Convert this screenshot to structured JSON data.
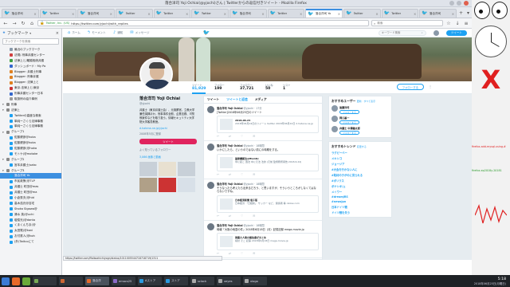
{
  "window": {
    "title": "落合洋司 Yoji Ochiai(@yjochi)さん | Twitterからの返信付きツイート - Mozilla Firefox"
  },
  "tabs": [
    {
      "label": "落合洋司"
    },
    {
      "label": "Twitter"
    },
    {
      "label": "落合洋司"
    },
    {
      "label": "Twitter"
    },
    {
      "label": "Twitter"
    },
    {
      "label": "Twitter"
    },
    {
      "label": "落合洋司"
    },
    {
      "label": "Twitter"
    },
    {
      "label": "落合洋司 Yo",
      "active": true
    },
    {
      "label": "Twitter"
    },
    {
      "label": "Twitter"
    },
    {
      "label": "落合洋司"
    }
  ],
  "navbar": {
    "site": "Twitter, Inc. (US)",
    "url": "https://twitter.com/yjochi/with_replies",
    "search_placeholder": "検索"
  },
  "sidebar": {
    "title": "ブックマーク",
    "search_placeholder": "ブックマークを検索",
    "items": [
      {
        "label": "最近のブックマーク",
        "color": "#8899aa"
      },
      {
        "label": "法規/-刑事弁護センター",
        "color": "#d04040"
      },
      {
        "label": "法律上と/離婚相続弁護",
        "color": "#40a040"
      },
      {
        "label": "ダッシュボード・My Po",
        "color": "#3366cc"
      },
      {
        "label": "Blogger: 弁護士刑事",
        "color": "#e08020"
      },
      {
        "label": "Blogger: 刑事弁護",
        "color": "#e08020"
      },
      {
        "label": "Blogger: 法律上と",
        "color": "#e08020"
      },
      {
        "label": "東京-法律上と/東京",
        "color": "#cc3333"
      },
      {
        "label": "刑事弁護センター日本",
        "color": "#3366cc"
      },
      {
        "label": "取扱例の紹介事例",
        "color": "#999999"
      },
      {
        "label": "刑事",
        "color": "#888888",
        "folder": true
      },
      {
        "label": "法律上",
        "color": "#888888",
        "folder": true
      },
      {
        "label": "Twitterの高度な検索",
        "color": "#1da1f2"
      },
      {
        "label": "単純ーさくら法律事務",
        "color": "#1da1f2"
      },
      {
        "label": "単純ーさくら法律事務",
        "color": "#1da1f2"
      },
      {
        "label": "グループ1",
        "color": "#888888",
        "folder": true
      },
      {
        "label": "佐藤健彦@hoka",
        "color": "#1da1f2"
      },
      {
        "label": "佐藤健彦@hoka",
        "color": "#1da1f2"
      },
      {
        "label": "佐藤健彦(@hoka",
        "color": "#1da1f2"
      },
      {
        "label": "モトケ(@motoke",
        "color": "#1da1f2"
      },
      {
        "label": "グループ2",
        "color": "#888888",
        "folder": true
      },
      {
        "label": "宮本弁護士(sako",
        "color": "#1da1f2"
      },
      {
        "label": "グループ3",
        "color": "#888888",
        "folder": true
      },
      {
        "label": "落合洋司 Yo",
        "color": "#1da1f2",
        "selected": true
      },
      {
        "label": "市民政策(@TLP",
        "color": "#1da1f2"
      },
      {
        "label": "弁護士 町田@mas",
        "color": "#1da1f2"
      },
      {
        "label": "弁護士 町田@ma",
        "color": "#1da1f2"
      },
      {
        "label": "小倉秀夫(@hid",
        "color": "#1da1f2"
      },
      {
        "label": "高木浩光@自宅",
        "color": "#1da1f2"
      },
      {
        "label": "Shoko Sigawa@",
        "color": "#1da1f2"
      },
      {
        "label": "清水 英(@uchi",
        "color": "#1da1f2"
      },
      {
        "label": "壇俊光(@danto",
        "color": "#1da1f2"
      },
      {
        "label": "くまくんちま(@",
        "color": "#1da1f2"
      },
      {
        "label": "太田晃(@koni",
        "color": "#1da1f2"
      },
      {
        "label": "お付書人(@koh",
        "color": "#1da1f2"
      },
      {
        "label": "(外)Twitcoにて",
        "color": "#1da1f2"
      }
    ]
  },
  "twitter_nav": {
    "home": "ホーム",
    "moments": "モーメント",
    "notifications": "通知",
    "messages": "メッセージ",
    "search_placeholder": "キーワード検索",
    "tweet_button": "ツイート"
  },
  "profile_stats": [
    {
      "label": "ツイート",
      "value": "81,929",
      "active": true
    },
    {
      "label": "フォロー",
      "value": "199"
    },
    {
      "label": "フォロワー",
      "value": "37,721"
    },
    {
      "label": "いいね",
      "value": "50"
    },
    {
      "label": "リスト",
      "value": "1"
    }
  ],
  "profile": {
    "name": "落合洋司 Yoji Ochiai",
    "handle": "@yjochi",
    "bio": "弁護士（東京弁護士会）、元検察官、立教大学兼任講師ほか。刑事事件全般、企業法務、IT関係案件などを取り扱う。情報セキュリティ大学院大学客員教授。",
    "link": "d.hatena.ne.jp/yjochi",
    "joined": "2008年5月に登録",
    "tweet_to_button": "ツイート",
    "followers_known": "よく知っているフォロワー",
    "photos_label": "3,066 画像と動画",
    "follow_button": "フォローする"
  },
  "timeline": {
    "tabs": [
      "ツイート",
      "ツイートと返信",
      "メディア"
    ],
    "tweets": [
      {
        "name": "落合洋司 Yoji Ochiai",
        "handle": "@yjochi · 17分",
        "text": "[Twitter]2018年06月25日のツイート",
        "card_title": "2018-06-24",
        "card_text": "2018年06月24日のツイート twitter 2018年06月24日 d.hatena.ne.jp"
      },
      {
        "name": "落合洋司 Yoji Ochiai",
        "handle": "@yjochi · 18時間",
        "text": "いかにしたら、というのではない前にの時期をする。",
        "card_title": "国家機能法@ffeintlc",
        "card_text": "中に起こ 国法 中に元法 法的 (元前 監督務所報告 2018.6.24)"
      },
      {
        "name": "落合洋司 Yoji Ochiai",
        "handle": "@yjochi · 18時間",
        "text": "そうなったら考えたら出来るだろう、と思いますが、そういうところがしなくてはならないですね。",
        "card_title": "日本経済新聞 電子版",
        "card_text": "日本経済 「日経新」 サッカー など、関係者 等 nikkei.com"
      },
      {
        "name": "落合洋司 Yoji Ochiai",
        "handle": "@yjochi · 18時間",
        "text": "時報「大阪の地震の件」2018年6月18日（月）記憶記録 mega-movie.jp",
        "card_title": "後藤大人後の報告書がまとめ",
        "card_text": "検討 そこ 記事 2018年6月18日 mega-movie.jp"
      }
    ]
  },
  "who_to_follow": {
    "title": "おすすめユーザー",
    "refresh": "更新 · すべて表示",
    "users": [
      {
        "name": "後藤洋司",
        "follow": "フォローする"
      },
      {
        "name": "岡口基一",
        "follow": "フォローする"
      },
      {
        "name": "弁護士 中澤健太郎",
        "follow": "フォローする"
      }
    ]
  },
  "trends": {
    "title": "おすすめトレンド",
    "change": "変更する",
    "items": [
      {
        "name": "ラグビーベー",
        "sub": ""
      },
      {
        "name": "メキシコ",
        "sub": ""
      },
      {
        "name": "ジョージア",
        "sub": ""
      },
      {
        "name": "#大会を行かない人に",
        "sub": ""
      },
      {
        "name": "#取材の子がのに見られる",
        "sub": ""
      },
      {
        "name": "#ポリクス",
        "sub": ""
      },
      {
        "name": "ボナシオ/ェ",
        "sub": ""
      },
      {
        "name": "メイワー",
        "sub": ""
      },
      {
        "name": "#dreamJRS",
        "sub": ""
      },
      {
        "name": "#newsjpn",
        "sub": ""
      },
      {
        "name": "日本ドイツ戦",
        "sub": ""
      },
      {
        "name": "ドイツ戦を失う",
        "sub": ""
      }
    ]
  },
  "statusbar": {
    "text": "https://twitter.com/ffoikoahichiyogn/status/1011005544718718719/1311"
  },
  "desktop": {
    "red_text": "firefox-add-mysql-using.#",
    "green_text": "firefox-ep2018y-20181"
  },
  "taskbar": {
    "tasks": [
      {
        "label": "",
        "color": "#7a5"
      },
      {
        "label": "",
        "color": "#c63"
      },
      {
        "label": "落合洋",
        "color": "#e66a2a",
        "active": true
      },
      {
        "label": "emacs25",
        "color": "#8a6ac8"
      },
      {
        "label": "Aストア",
        "color": "#2a9adf"
      },
      {
        "label": "ストア",
        "color": "#2a9adf"
      },
      {
        "label": "sclock",
        "color": "#aaa"
      },
      {
        "label": "xeyes",
        "color": "#aaa"
      },
      {
        "label": "xlogo",
        "color": "#aaa"
      }
    ],
    "time": "5:18",
    "date": "2018年06月25日(月曜日)"
  }
}
